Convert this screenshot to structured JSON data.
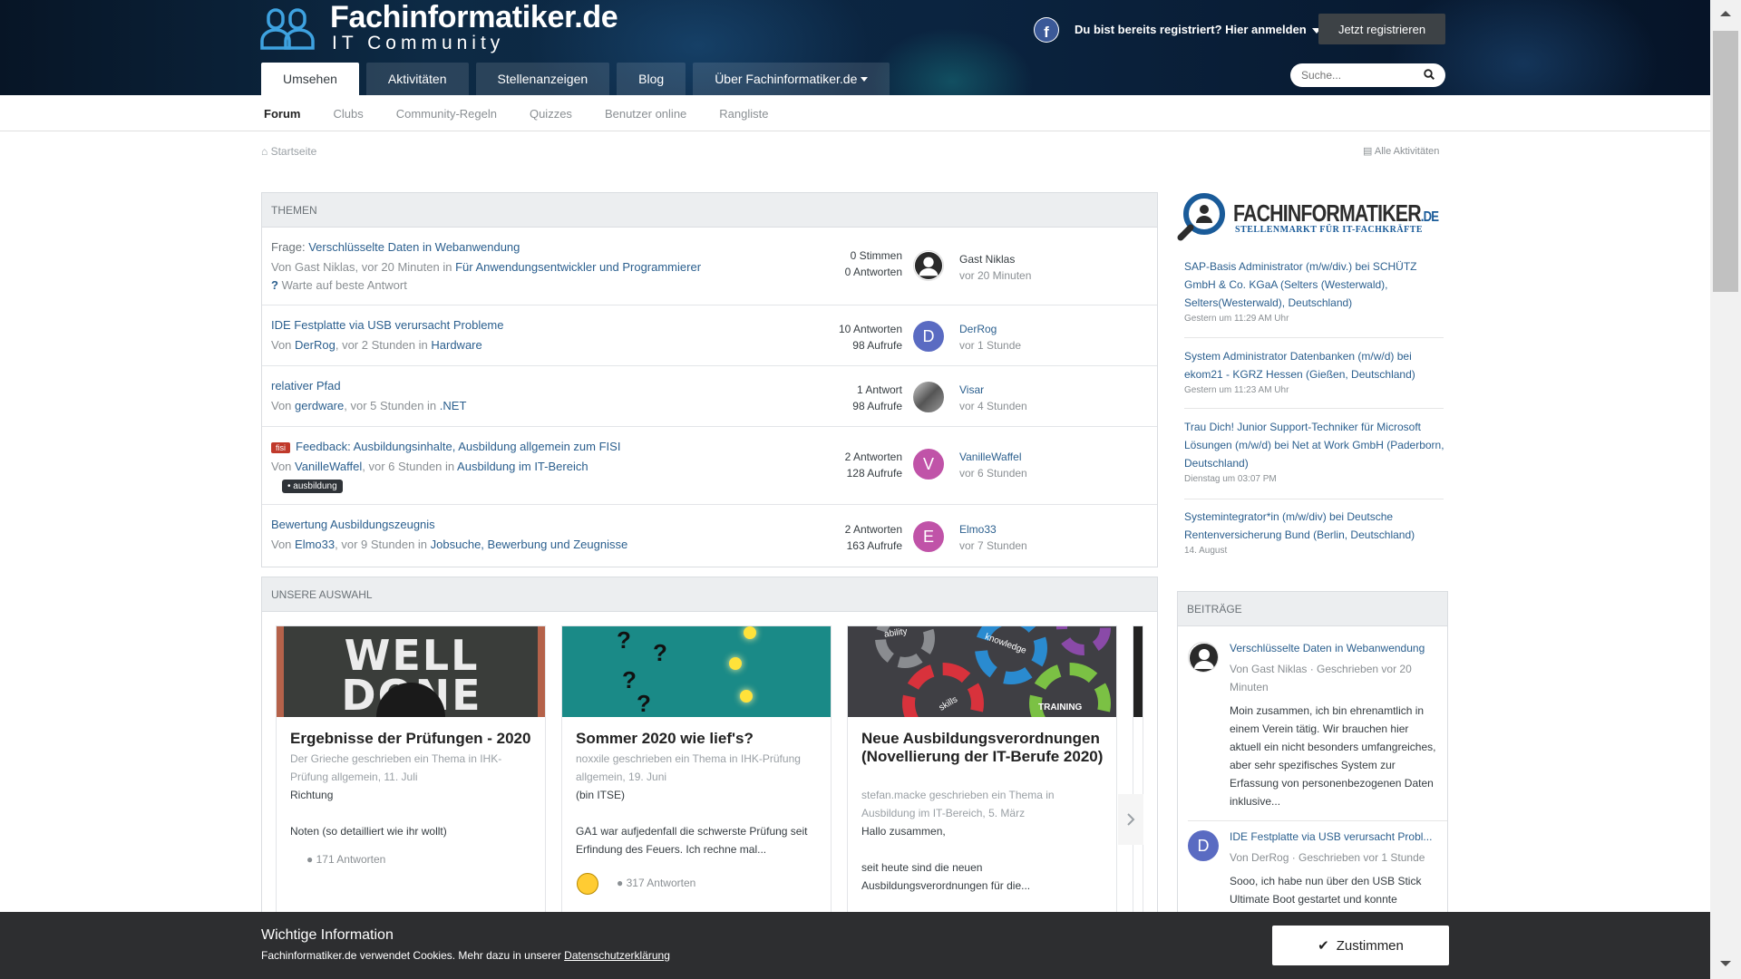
{
  "header": {
    "logo_title": "Fachinformatiker",
    "logo_tld": ".de",
    "logo_subtitle": "IT Community",
    "signin": "Du bist bereits registriert? Hier anmelden",
    "register": "Jetzt registrieren",
    "facebook_letter": "f",
    "search_placeholder": "Suche...",
    "nav": [
      "Umsehen",
      "Aktivitäten",
      "Stellenanzeigen",
      "Blog",
      "Über Fachinformatiker.de"
    ]
  },
  "subnav": [
    "Forum",
    "Clubs",
    "Community-Regeln",
    "Quizzes",
    "Benutzer online",
    "Rangliste"
  ],
  "breadcrumb": "Startseite",
  "all_activity": "Alle Aktivitäten",
  "topics_box": {
    "heading": "THEMEN",
    "topics": [
      {
        "prefix_label": "Frage:",
        "title": "Verschlüsselte Daten in Webanwendung",
        "by": "Von Gast Niklas, vor 20 Minuten in",
        "author": "",
        "forum": "Für Anwendungsentwickler und Programmierer",
        "status": "Warte auf beste Antwort",
        "stat1": "0 Stimmen",
        "stat2": "0 Antworten",
        "last_user": "Gast Niklas",
        "last_time": "vor 20 Minuten",
        "avatar_letter": "",
        "avatar_color": "#ffffff"
      },
      {
        "title": "IDE Festplatte via USB verursacht Probleme",
        "by": "Von",
        "author": "DerRog",
        "when": ", vor 2 Stunden in",
        "forum": "Hardware",
        "stat1": "10 Antworten",
        "stat2": "98 Aufrufe",
        "last_user": "DerRog",
        "last_time": "vor 1 Stunde",
        "avatar_letter": "D",
        "avatar_color": "#5a6bc2"
      },
      {
        "title": "relativer Pfad",
        "by": "Von",
        "author": "gerdware",
        "when": ", vor 5 Stunden in",
        "forum": ".NET",
        "stat1": "1 Antwort",
        "stat2": "98 Aufrufe",
        "last_user": "Visar",
        "last_time": "vor 4 Stunden",
        "avatar_letter": "",
        "avatar_color": "#8a8f93"
      },
      {
        "prefix": "fisi",
        "title": "Feedback: Ausbildungsinhalte, Ausbildung allgemein zum FISI",
        "by": "Von",
        "author": "VanilleWaffel",
        "when": ", vor 6 Stunden in",
        "forum": "Ausbildung im IT-Bereich",
        "tag": "ausbildung",
        "stat1": "2 Antworten",
        "stat2": "128 Aufrufe",
        "last_user": "VanilleWaffel",
        "last_time": "vor 6 Stunden",
        "avatar_letter": "V",
        "avatar_color": "#c053a8"
      },
      {
        "title": "Bewertung Ausbildungszeugnis",
        "by": "Von",
        "author": "Elmo33",
        "when": ", vor 9 Stunden in",
        "forum": "Jobsuche, Bewerbung und Zeugnisse",
        "stat1": "2 Antworten",
        "stat2": "163 Aufrufe",
        "last_user": "Elmo33",
        "last_time": "vor 7 Stunden",
        "avatar_letter": "E",
        "avatar_color": "#c053a8"
      }
    ]
  },
  "featured_box": {
    "heading": "UNSERE AUSWAHL",
    "cards": [
      {
        "title": "Ergebnisse der Prüfungen - 2020",
        "meta": "Der Grieche geschrieben ein Thema in IHK-Prüfung allgemein, 11. Juli",
        "body1": "Richtung",
        "body2": "Noten (so detailliert wie ihr wollt)",
        "count": "171 Antworten",
        "img_text": "WELL DONE"
      },
      {
        "title": "Sommer 2020 wie lief's?",
        "meta": "noxxile geschrieben ein Thema in IHK-Prüfung allgemein, 19. Juni",
        "body1": "(bin ITSE)",
        "body2": "GA1 war aufjedenfall die schwerste Prüfung seit Erfindung des Feuers. Ich rechne mal...",
        "count": "317 Antworten"
      },
      {
        "title": "Neue Ausbildungsverordnungen (Novellierung der IT-Berufe 2020)",
        "meta": "stefan.macke geschrieben ein Thema in Ausbildung im IT-Bereich, 5. März",
        "body1": "Hallo zusammen,",
        "body2": "seit heute sind die neuen Ausbildungsverordnungen für die...",
        "gears": [
          "ability",
          "knowledge",
          "skills",
          "TRAINING"
        ]
      }
    ]
  },
  "ad": {
    "brand": "FACHINFORMATIKER",
    "brand_tld": ".DE",
    "tagline": "STELLENMARKT FÜR IT-FACHKRÄFTE"
  },
  "jobs": [
    {
      "title": "SAP-Basis Administrator (m/w/div.) bei SCHÜTZ GmbH & Co. KGaA (Selters (Westerwald), Selters(Westerwald), Deutschland)",
      "date": "Gestern um 11:29 AM Uhr"
    },
    {
      "title": "System Administrator Datenbanken (m/w/d) bei ekom21 - KGRZ Hessen (Gießen, Deutschland)",
      "date": "Gestern um 11:23 AM Uhr"
    },
    {
      "title": "Trau Dich! Junior Support-Techniker für Microsoft Lösungen (m/w/d) bei Net at Work GmbH (Paderborn, Deutschland)",
      "date": "Dienstag um 03:07 PM"
    },
    {
      "title": "Systemintegrator*in (m/w/div) bei Deutsche Rentenversicherung Bund (Berlin, Deutschland)",
      "date": "14. August"
    }
  ],
  "posts_box": {
    "heading": "BEITRÄGE",
    "posts": [
      {
        "title": "Verschlüsselte Daten in Webanwendung",
        "meta": "Von Gast Niklas · Geschrieben vor 20 Minuten",
        "body": "Moin zusammen, ich bin ehrenamtlich in einem Verein tätig. Wir brauchen hier aktuell ein nicht besonders umfangreiches, aber sehr spezifisches System zur Erfassung von personenbezogenen Daten inklusive...",
        "avatar_letter": "",
        "avatar_color": "#ffffff"
      },
      {
        "title": "IDE Festplatte via USB verursacht Probl...",
        "meta": "Von DerRog · Geschrieben vor 1 Stunde",
        "body": "Sooo, ich habe nun über den USB Stick Ultimate Boot gestartet und konnte",
        "avatar_letter": "D",
        "avatar_color": "#5a6bc2"
      }
    ]
  },
  "cookie": {
    "heading": "Wichtige Information",
    "text": "Fachinformatiker.de verwendet Cookies. Mehr dazu in unserer",
    "link": "Datenschutzerklärung",
    "accept": "Zustimmen"
  },
  "colors": {
    "link": "#2b5f8e",
    "header_bg": "#0b2440",
    "cookie_bg": "#2d2e30"
  }
}
